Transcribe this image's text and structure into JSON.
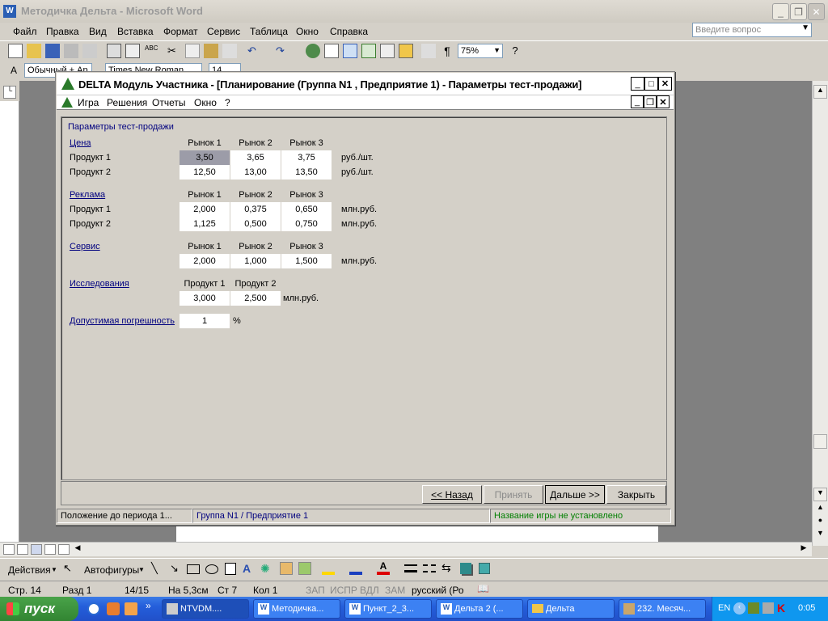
{
  "word": {
    "title": "Методичка Дельта - Microsoft Word",
    "menu": [
      "Файл",
      "Правка",
      "Вид",
      "Вставка",
      "Формат",
      "Сервис",
      "Таблица",
      "Окно",
      "Справка"
    ],
    "ask_placeholder": "Введите вопрос",
    "zoom": "75%",
    "style": "Обычный + Ар",
    "font": "Times New Roman",
    "size": "14",
    "drawing": {
      "actions": "Действия",
      "autoshapes": "Автофигуры"
    },
    "status": {
      "page": "Стр. 14",
      "section": "Разд 1",
      "pages": "14/15",
      "at": "На 5,3см",
      "line": "Ст 7",
      "col": "Кол 1",
      "rec": "ЗАП",
      "trk": "ИСПР",
      "ext": "ВДЛ",
      "ovr": "ЗАМ",
      "lang": "русский (Ро"
    }
  },
  "dialog": {
    "title": "DELTA Модуль Участника - [Планирование (Группа N1 , Предприятие 1) - Параметры тест-продажи]",
    "menu": [
      "Игра",
      "Решения",
      "Отчеты",
      "Окно",
      "?"
    ],
    "heading": "Параметры тест-продажи",
    "markets": [
      "Рынок 1",
      "Рынок 2",
      "Рынок 3"
    ],
    "price": {
      "label": "Цена",
      "unit": "руб./шт.",
      "rows": [
        {
          "name": "Продукт 1",
          "values": [
            "3,50",
            "3,65",
            "3,75"
          ]
        },
        {
          "name": "Продукт 2",
          "values": [
            "12,50",
            "13,00",
            "13,50"
          ]
        }
      ]
    },
    "ads": {
      "label": "Реклама",
      "unit": "млн.руб.",
      "rows": [
        {
          "name": "Продукт 1",
          "values": [
            "2,000",
            "0,375",
            "0,650"
          ]
        },
        {
          "name": "Продукт 2",
          "values": [
            "1,125",
            "0,500",
            "0,750"
          ]
        }
      ]
    },
    "service": {
      "label": "Сервис",
      "unit": "млн.руб.",
      "values": [
        "2,000",
        "1,000",
        "1,500"
      ]
    },
    "research": {
      "label": "Исследования",
      "unit": "млн.руб.",
      "products": [
        "Продукт 1",
        "Продукт 2"
      ],
      "values": [
        "3,000",
        "2,500"
      ]
    },
    "tolerance": {
      "label": "Допустимая погрешность",
      "value": "1",
      "unit": "%"
    },
    "buttons": {
      "back": "<< Назад",
      "accept": "Принять",
      "next": "Дальше >>",
      "close": "Закрыть"
    },
    "status": {
      "position": "Положение до периода 1...",
      "group": "Группа N1 / Предприятие 1",
      "game": "Название игры не установлено"
    }
  },
  "taskbar": {
    "start": "пуск",
    "tasks": [
      "NTVDM....",
      "Методичка...",
      "Пункт_2_3...",
      "Дельта 2 (...",
      "Дельта",
      "232. Месяч..."
    ],
    "lang": "EN",
    "time": "0:05"
  }
}
